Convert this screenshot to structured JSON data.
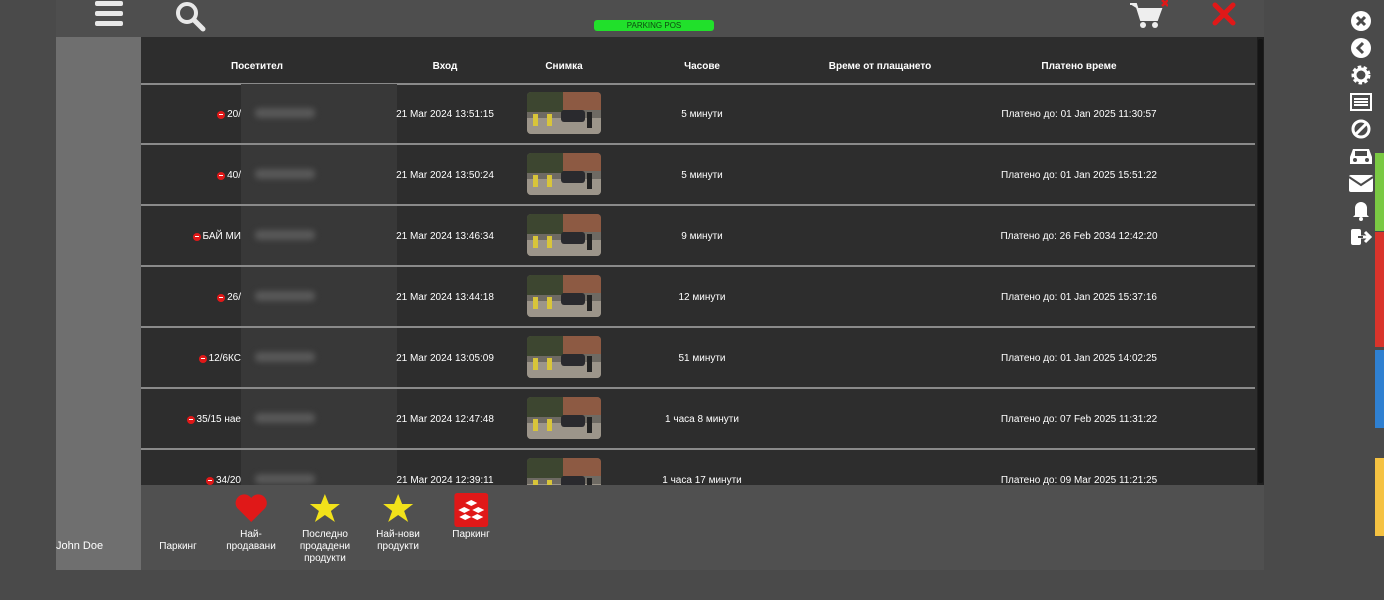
{
  "header": {
    "badge": "PARKING POS",
    "icons": [
      "menu-icon",
      "search-icon",
      "cart-icon",
      "close-icon"
    ]
  },
  "table": {
    "columns": [
      "Посетител",
      "Вход",
      "Снимка",
      "Часове",
      "Време от плащането",
      "Платено време"
    ],
    "rows": [
      {
        "visitor": "20/",
        "entry": "21 Mar 2024 13:51:15",
        "hours": "5 минути",
        "paid_time": "",
        "paid": "Платено до: 01 Jan 2025 11:30:57"
      },
      {
        "visitor": "40/",
        "entry": "21 Mar 2024 13:50:24",
        "hours": "5 минути",
        "paid_time": "",
        "paid": "Платено до: 01 Jan 2025 15:51:22"
      },
      {
        "visitor": "БАЙ МИ",
        "entry": "21 Mar 2024 13:46:34",
        "hours": "9 минути",
        "paid_time": "",
        "paid": "Платено до: 26 Feb 2034 12:42:20"
      },
      {
        "visitor": "26/",
        "entry": "21 Mar 2024 13:44:18",
        "hours": "12 минути",
        "paid_time": "",
        "paid": "Платено до: 01 Jan 2025 15:37:16"
      },
      {
        "visitor": "12/6КС",
        "entry": "21 Mar 2024 13:05:09",
        "hours": "51 минути",
        "paid_time": "",
        "paid": "Платено до: 01 Jan 2025 14:02:25"
      },
      {
        "visitor": "35/15 нае",
        "entry": "21 Mar 2024 12:47:48",
        "hours": "1 часа  8 минути",
        "paid_time": "",
        "paid": "Платено до: 07 Feb 2025 11:31:22"
      },
      {
        "visitor": "34/20",
        "entry": "21 Mar 2024 12:39:11",
        "hours": "1 часа  17 минути",
        "paid_time": "",
        "paid": "Платено до: 09 Mar 2025 11:21:25"
      }
    ]
  },
  "user": {
    "name": "John Doe"
  },
  "quick_buttons": [
    {
      "label": "Паркинг",
      "icon": ""
    },
    {
      "label": "Най-\nпродавани",
      "icon": "heart-icon"
    },
    {
      "label": "Последно\nпродадени\nпродукти",
      "icon": "star-icon"
    },
    {
      "label": "Най-нови\nпродукти",
      "icon": "star-icon"
    },
    {
      "label": "Паркинг",
      "icon": "boxes-icon"
    }
  ],
  "sidebar_icons": [
    "close-circle-icon",
    "back-circle-icon",
    "gear-icon",
    "list-icon",
    "ban-icon",
    "car-icon",
    "envelope-icon",
    "bell-icon",
    "logout-icon"
  ],
  "colors": {
    "badge": "#21e02b",
    "accent_red": "#e01818",
    "tab_green": "#7ac943",
    "tab_red": "#d9342b",
    "tab_blue": "#2f80d1",
    "tab_yellow": "#f5c242"
  }
}
